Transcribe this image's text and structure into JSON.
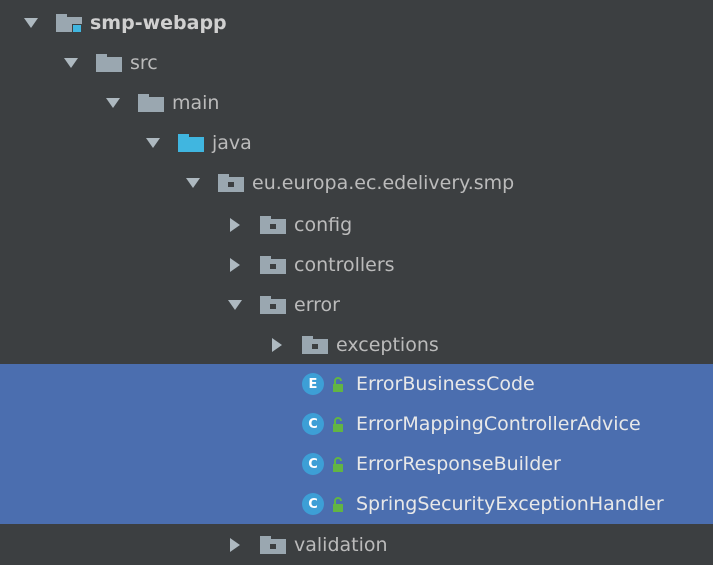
{
  "project_tree": {
    "module": {
      "label": "smp-webapp",
      "icon": "module-folder-icon",
      "expanded": true
    },
    "src": {
      "label": "src",
      "icon": "folder-icon",
      "expanded": true
    },
    "main": {
      "label": "main",
      "icon": "folder-icon",
      "expanded": true
    },
    "java": {
      "label": "java",
      "icon": "source-root-folder-icon",
      "expanded": true
    },
    "package_root": {
      "label": "eu.europa.ec.edelivery.smp",
      "icon": "package-icon",
      "expanded": true
    },
    "config": {
      "label": "config",
      "icon": "package-icon",
      "expanded": false
    },
    "controllers": {
      "label": "controllers",
      "icon": "package-icon",
      "expanded": false
    },
    "error": {
      "label": "error",
      "icon": "package-icon",
      "expanded": true
    },
    "exceptions": {
      "label": "exceptions",
      "icon": "package-icon",
      "expanded": false
    },
    "files": [
      {
        "kind": "E",
        "label": "ErrorBusinessCode",
        "selected": true
      },
      {
        "kind": "C",
        "label": "ErrorMappingControllerAdvice",
        "selected": true
      },
      {
        "kind": "C",
        "label": "ErrorResponseBuilder",
        "selected": true
      },
      {
        "kind": "C",
        "label": "SpringSecurityExceptionHandler",
        "selected": true
      }
    ],
    "validation": {
      "label": "validation",
      "icon": "package-icon",
      "expanded": false
    }
  },
  "colors": {
    "background": "#3c3f41",
    "selection": "#4b6eaf",
    "folder": "#9aa7b0",
    "source_root": "#40b6e0",
    "class_badge": "#3d9fd6",
    "lock": "#62b543"
  }
}
